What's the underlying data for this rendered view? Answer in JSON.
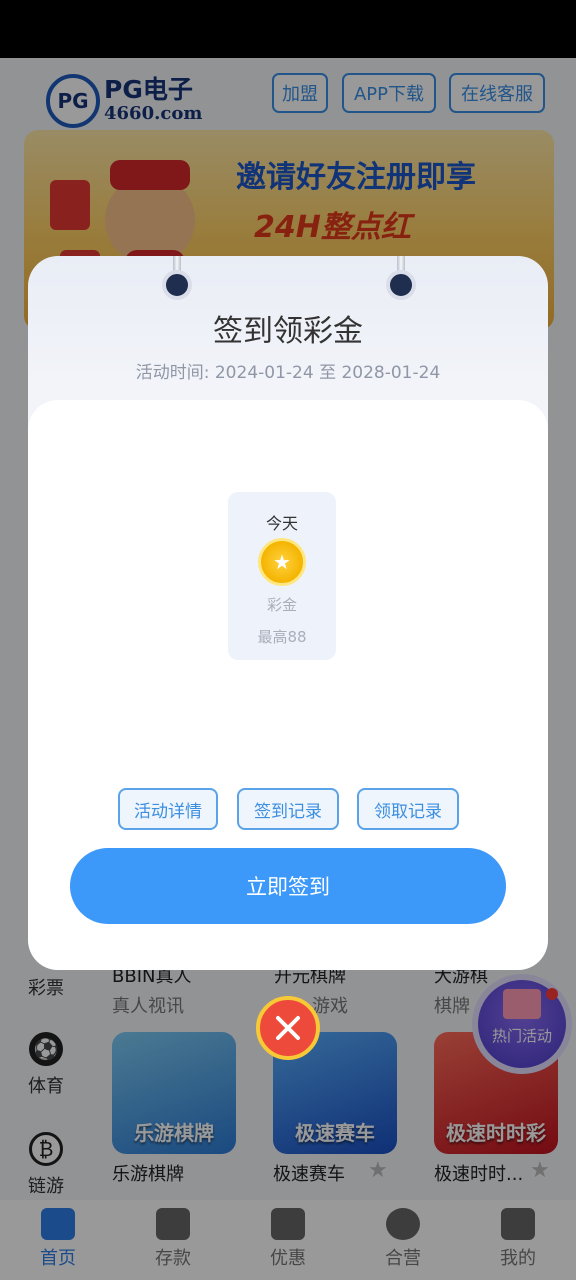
{
  "header": {
    "logo_text": "PG",
    "brand_name": "PG电子",
    "brand_domain": "4660.com",
    "buttons": [
      "加盟",
      "APP下载",
      "在线客服"
    ]
  },
  "banner": {
    "title": "邀请好友注册即享",
    "subtitle": "24H整点红"
  },
  "side_nav": [
    "彩票",
    "体育",
    "链游"
  ],
  "games": {
    "row1": [
      {
        "name": "BBIN真人",
        "sub": "真人视讯"
      },
      {
        "name": "开元棋牌",
        "sub": "游戏"
      },
      {
        "name": "大游棋",
        "sub": "棋牌"
      }
    ],
    "row2": [
      {
        "name": "乐游棋牌",
        "card": "乐游棋牌"
      },
      {
        "name": "极速赛车",
        "card": "极速赛车"
      },
      {
        "name": "极速时时...",
        "card": "极速时时彩"
      }
    ]
  },
  "hot_activity": "热门活动",
  "tabbar": [
    {
      "label": "首页",
      "active": true
    },
    {
      "label": "存款",
      "active": false
    },
    {
      "label": "优惠",
      "active": false
    },
    {
      "label": "合营",
      "active": false
    },
    {
      "label": "我的",
      "active": false
    }
  ],
  "modal": {
    "title": "签到领彩金",
    "activity_time": "活动时间: 2024-01-24 至 2028-01-24",
    "day_card": {
      "day": "今天",
      "label": "彩金",
      "max": "最高88"
    },
    "links": [
      "活动详情",
      "签到记录",
      "领取记录"
    ],
    "checkin_button": "立即签到"
  },
  "colors": {
    "primary": "#3c99fa",
    "accent": "#2f7ee8",
    "close": "#ee4a3b"
  }
}
